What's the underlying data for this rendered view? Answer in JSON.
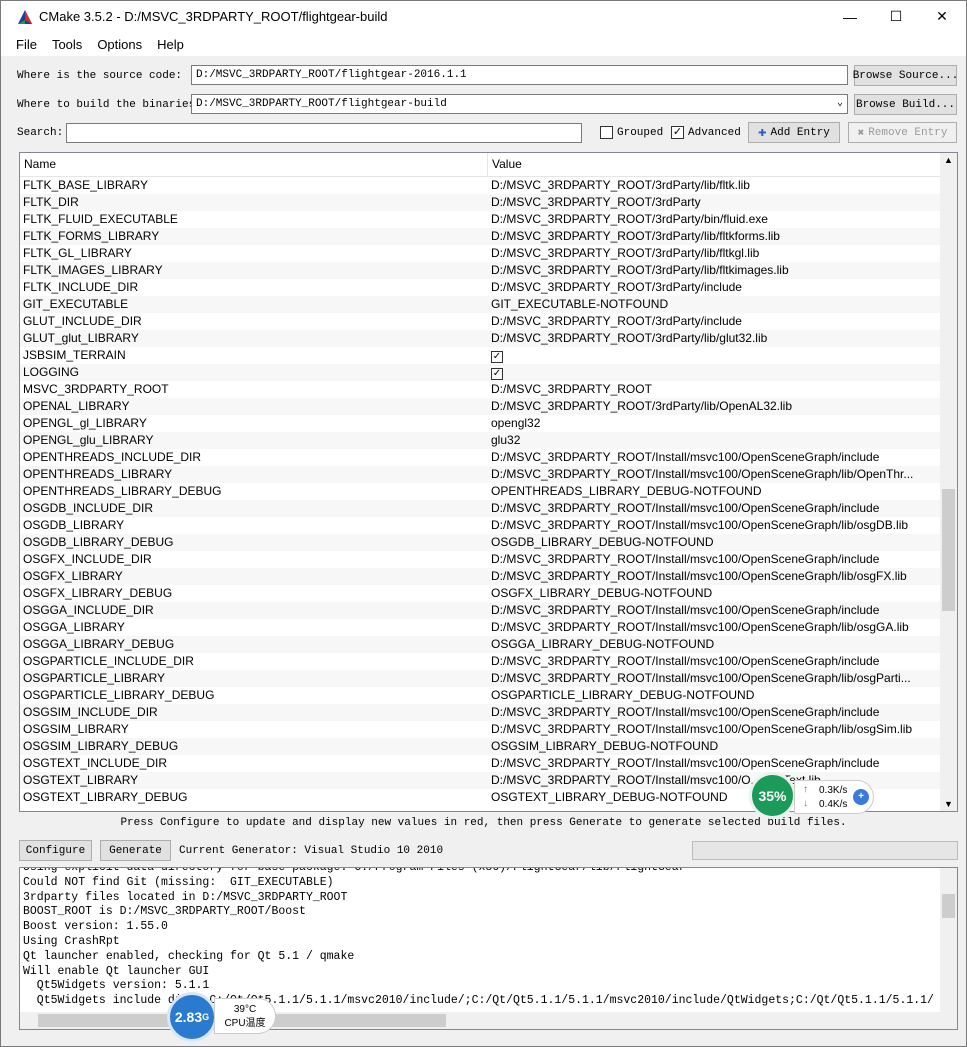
{
  "window": {
    "title": "CMake 3.5.2 - D:/MSVC_3RDPARTY_ROOT/flightgear-build",
    "minimize_icon": "minimize-icon",
    "maximize_icon": "maximize-icon",
    "close_icon": "close-icon"
  },
  "menu": [
    "File",
    "Tools",
    "Options",
    "Help"
  ],
  "source": {
    "label": "Where is the source code:",
    "value": "D:/MSVC_3RDPARTY_ROOT/flightgear-2016.1.1",
    "browse": "Browse Source..."
  },
  "build": {
    "label": "Where to build the binaries:",
    "value": "D:/MSVC_3RDPARTY_ROOT/flightgear-build",
    "browse": "Browse Build..."
  },
  "search": {
    "label": "Search:",
    "value": "",
    "grouped": "Grouped",
    "grouped_checked": false,
    "advanced": "Advanced",
    "advanced_checked": true,
    "add": "Add Entry",
    "remove": "Remove Entry"
  },
  "table": {
    "headers": [
      "Name",
      "Value"
    ],
    "rows": [
      [
        "FLTK_BASE_LIBRARY",
        "D:/MSVC_3RDPARTY_ROOT/3rdParty/lib/fltk.lib"
      ],
      [
        "FLTK_DIR",
        "D:/MSVC_3RDPARTY_ROOT/3rdParty"
      ],
      [
        "FLTK_FLUID_EXECUTABLE",
        "D:/MSVC_3RDPARTY_ROOT/3rdParty/bin/fluid.exe"
      ],
      [
        "FLTK_FORMS_LIBRARY",
        "D:/MSVC_3RDPARTY_ROOT/3rdParty/lib/fltkforms.lib"
      ],
      [
        "FLTK_GL_LIBRARY",
        "D:/MSVC_3RDPARTY_ROOT/3rdParty/lib/fltkgl.lib"
      ],
      [
        "FLTK_IMAGES_LIBRARY",
        "D:/MSVC_3RDPARTY_ROOT/3rdParty/lib/fltkimages.lib"
      ],
      [
        "FLTK_INCLUDE_DIR",
        "D:/MSVC_3RDPARTY_ROOT/3rdParty/include"
      ],
      [
        "GIT_EXECUTABLE",
        "GIT_EXECUTABLE-NOTFOUND"
      ],
      [
        "GLUT_INCLUDE_DIR",
        "D:/MSVC_3RDPARTY_ROOT/3rdParty/include"
      ],
      [
        "GLUT_glut_LIBRARY",
        "D:/MSVC_3RDPARTY_ROOT/3rdParty/lib/glut32.lib"
      ],
      [
        "JSBSIM_TERRAIN",
        "✓"
      ],
      [
        "LOGGING",
        "✓"
      ],
      [
        "MSVC_3RDPARTY_ROOT",
        "D:/MSVC_3RDPARTY_ROOT"
      ],
      [
        "OPENAL_LIBRARY",
        "D:/MSVC_3RDPARTY_ROOT/3rdParty/lib/OpenAL32.lib"
      ],
      [
        "OPENGL_gl_LIBRARY",
        "opengl32"
      ],
      [
        "OPENGL_glu_LIBRARY",
        "glu32"
      ],
      [
        "OPENTHREADS_INCLUDE_DIR",
        "D:/MSVC_3RDPARTY_ROOT/Install/msvc100/OpenSceneGraph/include"
      ],
      [
        "OPENTHREADS_LIBRARY",
        "D:/MSVC_3RDPARTY_ROOT/Install/msvc100/OpenSceneGraph/lib/OpenThr..."
      ],
      [
        "OPENTHREADS_LIBRARY_DEBUG",
        "OPENTHREADS_LIBRARY_DEBUG-NOTFOUND"
      ],
      [
        "OSGDB_INCLUDE_DIR",
        "D:/MSVC_3RDPARTY_ROOT/Install/msvc100/OpenSceneGraph/include"
      ],
      [
        "OSGDB_LIBRARY",
        "D:/MSVC_3RDPARTY_ROOT/Install/msvc100/OpenSceneGraph/lib/osgDB.lib"
      ],
      [
        "OSGDB_LIBRARY_DEBUG",
        "OSGDB_LIBRARY_DEBUG-NOTFOUND"
      ],
      [
        "OSGFX_INCLUDE_DIR",
        "D:/MSVC_3RDPARTY_ROOT/Install/msvc100/OpenSceneGraph/include"
      ],
      [
        "OSGFX_LIBRARY",
        "D:/MSVC_3RDPARTY_ROOT/Install/msvc100/OpenSceneGraph/lib/osgFX.lib"
      ],
      [
        "OSGFX_LIBRARY_DEBUG",
        "OSGFX_LIBRARY_DEBUG-NOTFOUND"
      ],
      [
        "OSGGA_INCLUDE_DIR",
        "D:/MSVC_3RDPARTY_ROOT/Install/msvc100/OpenSceneGraph/include"
      ],
      [
        "OSGGA_LIBRARY",
        "D:/MSVC_3RDPARTY_ROOT/Install/msvc100/OpenSceneGraph/lib/osgGA.lib"
      ],
      [
        "OSGGA_LIBRARY_DEBUG",
        "OSGGA_LIBRARY_DEBUG-NOTFOUND"
      ],
      [
        "OSGPARTICLE_INCLUDE_DIR",
        "D:/MSVC_3RDPARTY_ROOT/Install/msvc100/OpenSceneGraph/include"
      ],
      [
        "OSGPARTICLE_LIBRARY",
        "D:/MSVC_3RDPARTY_ROOT/Install/msvc100/OpenSceneGraph/lib/osgParti..."
      ],
      [
        "OSGPARTICLE_LIBRARY_DEBUG",
        "OSGPARTICLE_LIBRARY_DEBUG-NOTFOUND"
      ],
      [
        "OSGSIM_INCLUDE_DIR",
        "D:/MSVC_3RDPARTY_ROOT/Install/msvc100/OpenSceneGraph/include"
      ],
      [
        "OSGSIM_LIBRARY",
        "D:/MSVC_3RDPARTY_ROOT/Install/msvc100/OpenSceneGraph/lib/osgSim.lib"
      ],
      [
        "OSGSIM_LIBRARY_DEBUG",
        "OSGSIM_LIBRARY_DEBUG-NOTFOUND"
      ],
      [
        "OSGTEXT_INCLUDE_DIR",
        "D:/MSVC_3RDPARTY_ROOT/Install/msvc100/OpenSceneGraph/include"
      ],
      [
        "OSGTEXT_LIBRARY",
        "D:/MSVC_3RDPARTY_ROOT/Install/msvc100/O.../osgText.lib"
      ],
      [
        "OSGTEXT_LIBRARY_DEBUG",
        "OSGTEXT_LIBRARY_DEBUG-NOTFOUND"
      ]
    ]
  },
  "hint": "Press Configure to update and display new values in red, then press Generate to generate selected build files.",
  "actions": {
    "configure": "Configure",
    "generate": "Generate",
    "generator": "Current Generator: Visual Studio 10 2010"
  },
  "log": "Using explicit data directory for base package: C:/Program Files (x86)/FlightGear/lib/FlightGear\nCould NOT find Git (missing:  GIT_EXECUTABLE)\n3rdparty files located in D:/MSVC_3RDPARTY_ROOT\nBOOST_ROOT is D:/MSVC_3RDPARTY_ROOT/Boost\nBoost version: 1.55.0\nUsing CrashRpt\nQt launcher enabled, checking for Qt 5.1 / qmake\nWill enable Qt launcher GUI\n  Qt5Widgets version: 5.1.1\n  Qt5Widgets include dirs: C:/Qt/Qt5.1.1/5.1.1/msvc2010/include/;C:/Qt/Qt5.1.1/5.1.1/msvc2010/include/QtWidgets;C:/Qt/Qt5.1.1/5.1.1/",
  "overlay": {
    "net_percent": "35%",
    "up": "0.3K/s",
    "down": "0.4K/s",
    "cpu_freq": "2.83",
    "cpu_unit": "G",
    "cpu_temp": "39°C",
    "cpu_label": "CPU温度"
  }
}
